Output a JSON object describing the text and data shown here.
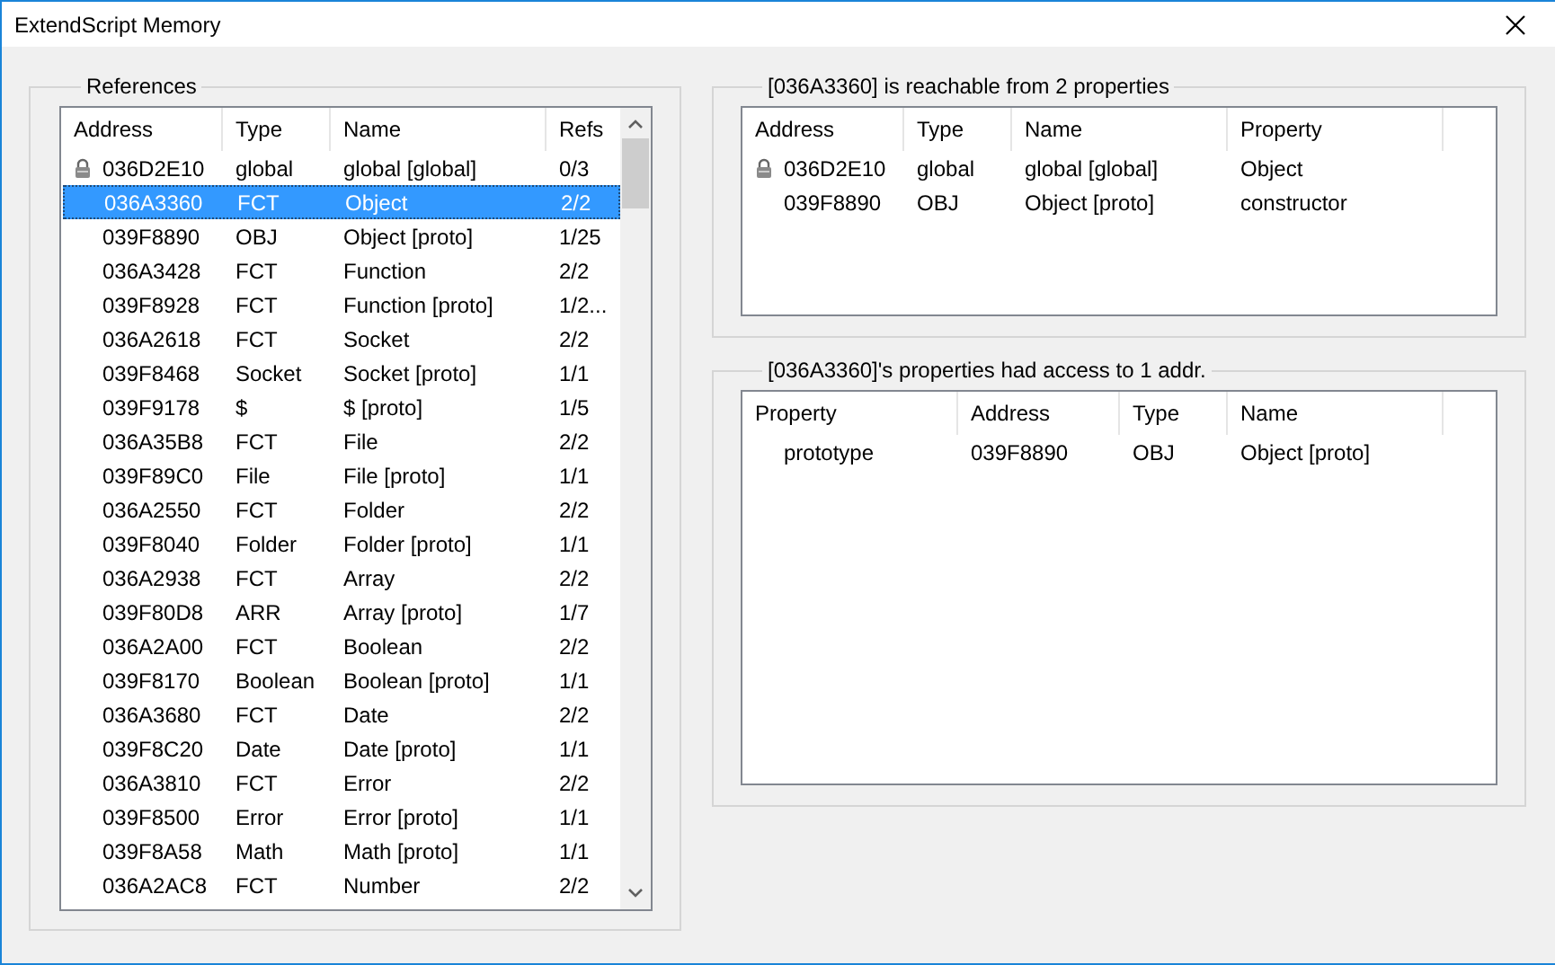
{
  "window": {
    "title": "ExtendScript Memory"
  },
  "references": {
    "title": "References",
    "columns": [
      "Address",
      "Type",
      "Name",
      "Refs"
    ],
    "rows": [
      {
        "address": "036D2E10",
        "type": "global",
        "name": "global [global]",
        "refs": "0/3",
        "locked": true,
        "selected": false
      },
      {
        "address": "036A3360",
        "type": "FCT",
        "name": "Object",
        "refs": "2/2",
        "locked": false,
        "selected": true
      },
      {
        "address": "039F8890",
        "type": "OBJ",
        "name": "Object [proto]",
        "refs": "1/25",
        "locked": false,
        "selected": false
      },
      {
        "address": "036A3428",
        "type": "FCT",
        "name": "Function",
        "refs": "2/2",
        "locked": false,
        "selected": false
      },
      {
        "address": "039F8928",
        "type": "FCT",
        "name": "Function [proto]",
        "refs": "1/2...",
        "locked": false,
        "selected": false
      },
      {
        "address": "036A2618",
        "type": "FCT",
        "name": "Socket",
        "refs": "2/2",
        "locked": false,
        "selected": false
      },
      {
        "address": "039F8468",
        "type": "Socket",
        "name": "Socket [proto]",
        "refs": "1/1",
        "locked": false,
        "selected": false
      },
      {
        "address": "039F9178",
        "type": "$",
        "name": "$ [proto]",
        "refs": "1/5",
        "locked": false,
        "selected": false
      },
      {
        "address": "036A35B8",
        "type": "FCT",
        "name": "File",
        "refs": "2/2",
        "locked": false,
        "selected": false
      },
      {
        "address": "039F89C0",
        "type": "File",
        "name": "File [proto]",
        "refs": "1/1",
        "locked": false,
        "selected": false
      },
      {
        "address": "036A2550",
        "type": "FCT",
        "name": "Folder",
        "refs": "2/2",
        "locked": false,
        "selected": false
      },
      {
        "address": "039F8040",
        "type": "Folder",
        "name": "Folder [proto]",
        "refs": "1/1",
        "locked": false,
        "selected": false
      },
      {
        "address": "036A2938",
        "type": "FCT",
        "name": "Array",
        "refs": "2/2",
        "locked": false,
        "selected": false
      },
      {
        "address": "039F80D8",
        "type": "ARR",
        "name": "Array [proto]",
        "refs": "1/7",
        "locked": false,
        "selected": false
      },
      {
        "address": "036A2A00",
        "type": "FCT",
        "name": "Boolean",
        "refs": "2/2",
        "locked": false,
        "selected": false
      },
      {
        "address": "039F8170",
        "type": "Boolean",
        "name": "Boolean [proto]",
        "refs": "1/1",
        "locked": false,
        "selected": false
      },
      {
        "address": "036A3680",
        "type": "FCT",
        "name": "Date",
        "refs": "2/2",
        "locked": false,
        "selected": false
      },
      {
        "address": "039F8C20",
        "type": "Date",
        "name": "Date [proto]",
        "refs": "1/1",
        "locked": false,
        "selected": false
      },
      {
        "address": "036A3810",
        "type": "FCT",
        "name": "Error",
        "refs": "2/2",
        "locked": false,
        "selected": false
      },
      {
        "address": "039F8500",
        "type": "Error",
        "name": "Error [proto]",
        "refs": "1/1",
        "locked": false,
        "selected": false
      },
      {
        "address": "039F8A58",
        "type": "Math",
        "name": "Math [proto]",
        "refs": "1/1",
        "locked": false,
        "selected": false
      },
      {
        "address": "036A2AC8",
        "type": "FCT",
        "name": "Number",
        "refs": "2/2",
        "locked": false,
        "selected": false
      }
    ]
  },
  "reachable": {
    "title": "[036A3360] is reachable from 2 properties",
    "columns": [
      "Address",
      "Type",
      "Name",
      "Property"
    ],
    "rows": [
      {
        "address": "036D2E10",
        "type": "global",
        "name": "global [global]",
        "property": "Object",
        "locked": true
      },
      {
        "address": "039F8890",
        "type": "OBJ",
        "name": "Object [proto]",
        "property": "constructor",
        "locked": false
      }
    ]
  },
  "access": {
    "title": "[036A3360]'s properties had access to 1 addr.",
    "columns": [
      "Property",
      "Address",
      "Type",
      "Name"
    ],
    "rows": [
      {
        "property": "prototype",
        "address": "039F8890",
        "type": "OBJ",
        "name": "Object [proto]"
      }
    ]
  }
}
